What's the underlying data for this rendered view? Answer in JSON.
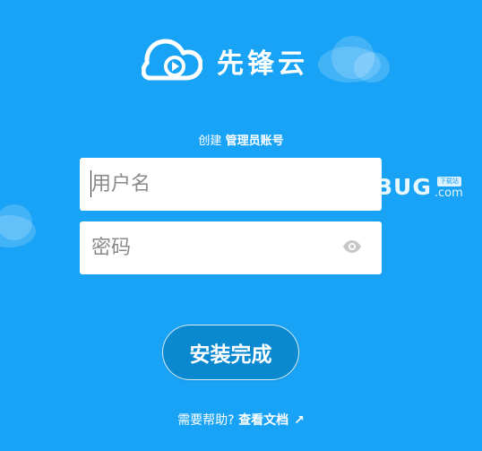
{
  "brand": {
    "name": "先锋云",
    "logo_icon": "cloud-play-icon"
  },
  "subtitle": {
    "prefix": "创建",
    "emphasis": "管理员账号"
  },
  "form": {
    "username_placeholder": "用户名",
    "password_placeholder": "密码",
    "password_toggle_icon": "eye-icon",
    "submit_label": "安装完成"
  },
  "help": {
    "question": "需要帮助?",
    "link_label": "查看文档",
    "link_icon": "arrow-up-right-icon",
    "link_glyph": "↗"
  },
  "watermark": {
    "main": "BUG",
    "tag": "下载站",
    "domain": ".com"
  },
  "colors": {
    "background": "#19a3f6",
    "button": "#0a89d1",
    "input_background": "#ffffff"
  }
}
